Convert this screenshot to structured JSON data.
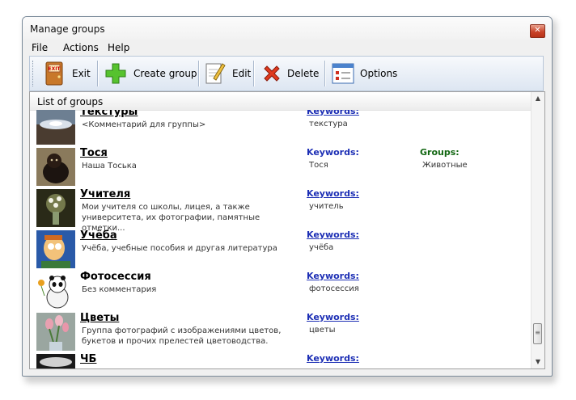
{
  "window": {
    "title": "Manage groups",
    "close_icon": "close-icon"
  },
  "menu": [
    "File",
    "Actions",
    "Help"
  ],
  "toolbar": [
    {
      "label": "Exit",
      "icon": "exit-icon"
    },
    {
      "label": "Create group",
      "icon": "plus-icon"
    },
    {
      "label": "Edit",
      "icon": "edit-icon"
    },
    {
      "label": "Delete",
      "icon": "delete-icon"
    },
    {
      "label": "Options",
      "icon": "options-icon"
    }
  ],
  "list": {
    "header": "List of groups",
    "keywords_label": "Keywords:",
    "groups_label": "Groups:",
    "rows": [
      {
        "name": "Текстуры",
        "comment": "<Комментарий для группы>",
        "keywords": "текстура",
        "groups": ""
      },
      {
        "name": "Тося",
        "comment": "Наша Тоська",
        "keywords": "Тося",
        "groups": "Животные"
      },
      {
        "name": "Учителя",
        "comment": "Мои учителя со школы, лицея, а также университета, их фотографии, памятные отметки...",
        "keywords": "учитель",
        "groups": ""
      },
      {
        "name": "Учёба",
        "comment": "Учёба, учебные пособия и другая литература",
        "keywords": "учёба",
        "groups": ""
      },
      {
        "name": "Фотосессия",
        "comment": "Без комментария",
        "keywords": "фотосессия",
        "groups": ""
      },
      {
        "name": "Цветы",
        "comment": "Группа фотографий с изображениями цветов, букетов и прочих прелестей цветоводства.",
        "keywords": "цветы",
        "groups": ""
      },
      {
        "name": "ЧБ",
        "comment": "",
        "keywords": "",
        "groups": ""
      }
    ]
  }
}
